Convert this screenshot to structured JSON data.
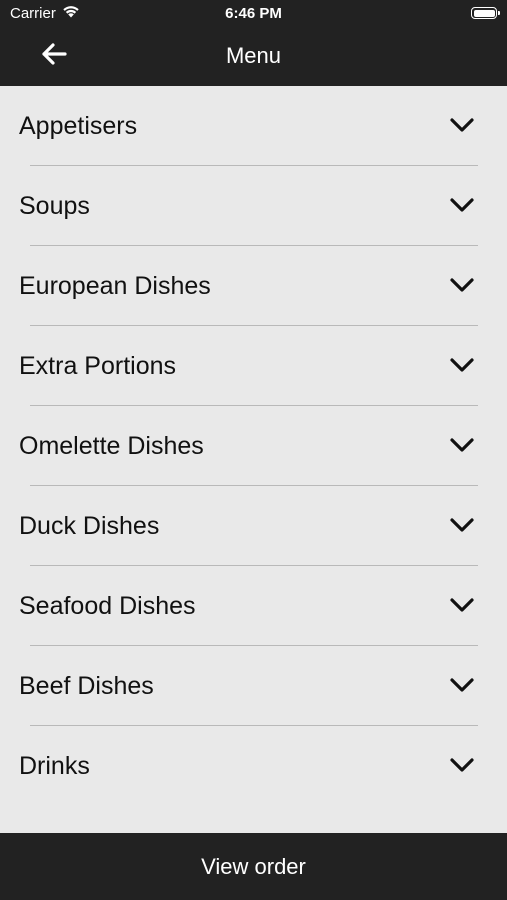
{
  "status_bar": {
    "carrier": "Carrier",
    "time": "6:46 PM",
    "wifi_icon": "wifi-icon",
    "battery_icon": "battery-icon"
  },
  "nav": {
    "title": "Menu",
    "back_icon": "arrow-left-icon"
  },
  "menu": {
    "items": [
      {
        "label": "Appetisers"
      },
      {
        "label": "Soups"
      },
      {
        "label": "European Dishes"
      },
      {
        "label": "Extra Portions"
      },
      {
        "label": "Omelette Dishes"
      },
      {
        "label": "Duck Dishes"
      },
      {
        "label": "Seafood Dishes"
      },
      {
        "label": "Beef Dishes"
      },
      {
        "label": "Drinks"
      }
    ],
    "expand_icon": "chevron-down-icon"
  },
  "footer": {
    "button_label": "View order"
  },
  "colors": {
    "bar_background": "#222222",
    "list_background": "#e9e9e9",
    "divider": "#b9b9b9",
    "text": "#111111"
  }
}
